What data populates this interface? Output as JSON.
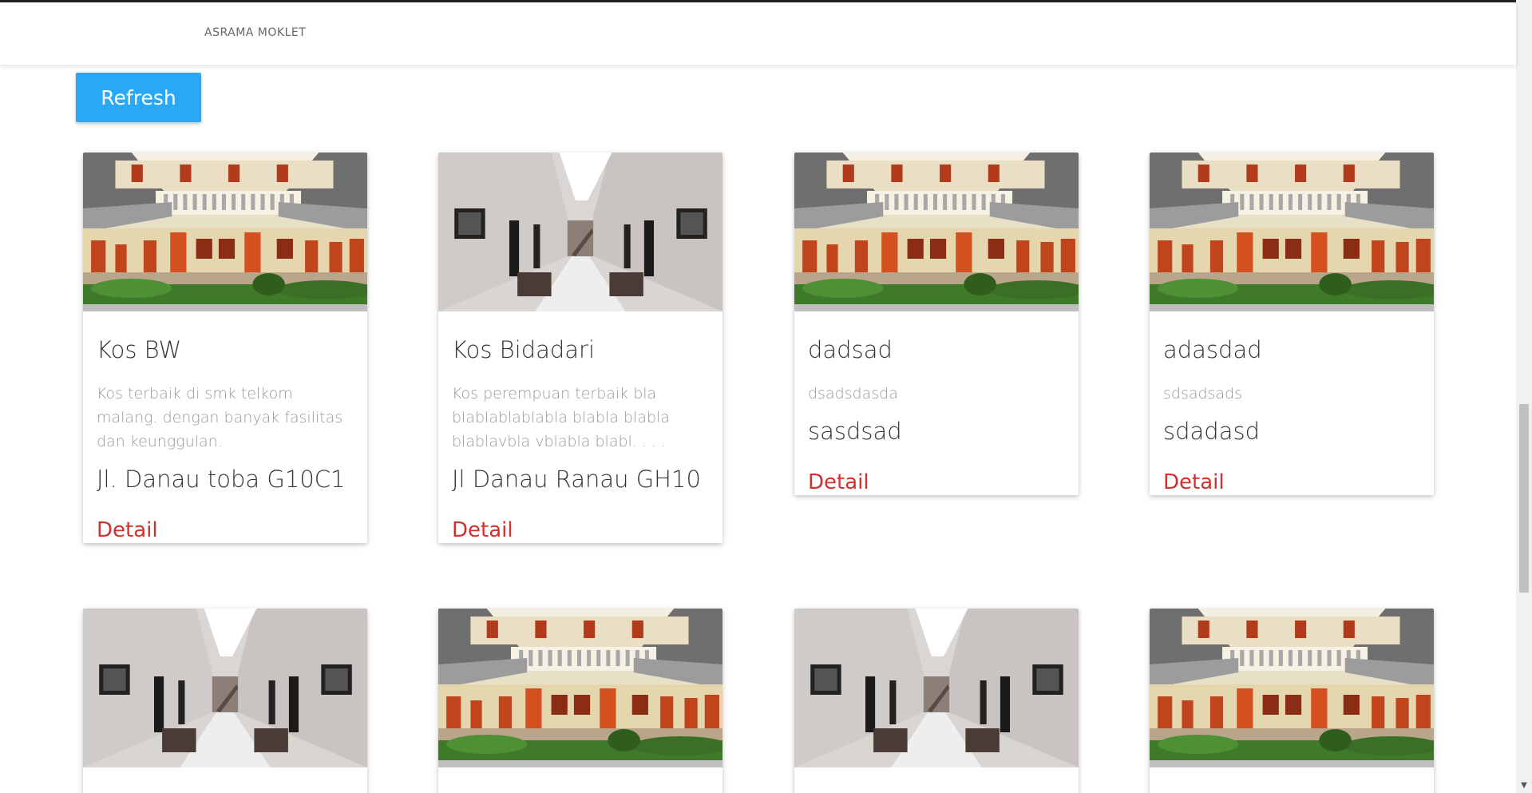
{
  "navbar": {
    "brand": "ASRAMA MOKLET"
  },
  "toolbar": {
    "refresh_label": "Refresh"
  },
  "cards": [
    {
      "title": "Kos BW",
      "description": "Kos terbaik di smk telkom malang. dengan banyak fasilitas dan keunggulan.",
      "address": "Jl. Danau toba G10C1",
      "detail_label": "Detail",
      "image": "courtyard-photo"
    },
    {
      "title": "Kos Bidadari",
      "description": "Kos perempuan terbaik bla blablablablabla blabla blabla blablavbla vblabla blabl. . . .",
      "address": "Jl Danau Ranau GH10",
      "detail_label": "Detail",
      "image": "hallway-photo"
    },
    {
      "title": "dadsad",
      "description": "dsadsdasda",
      "address": "sasdsad",
      "detail_label": "Detail",
      "image": "courtyard-photo"
    },
    {
      "title": "adasdad",
      "description": "sdsadsads",
      "address": "sdadasd",
      "detail_label": "Detail",
      "image": "courtyard-photo"
    },
    {
      "image": "hallway-photo"
    },
    {
      "image": "courtyard-photo"
    },
    {
      "image": "hallway-photo"
    },
    {
      "image": "courtyard-photo"
    }
  ],
  "colors": {
    "accent": "#2aa8f5",
    "detail_link": "#d32f2f"
  }
}
